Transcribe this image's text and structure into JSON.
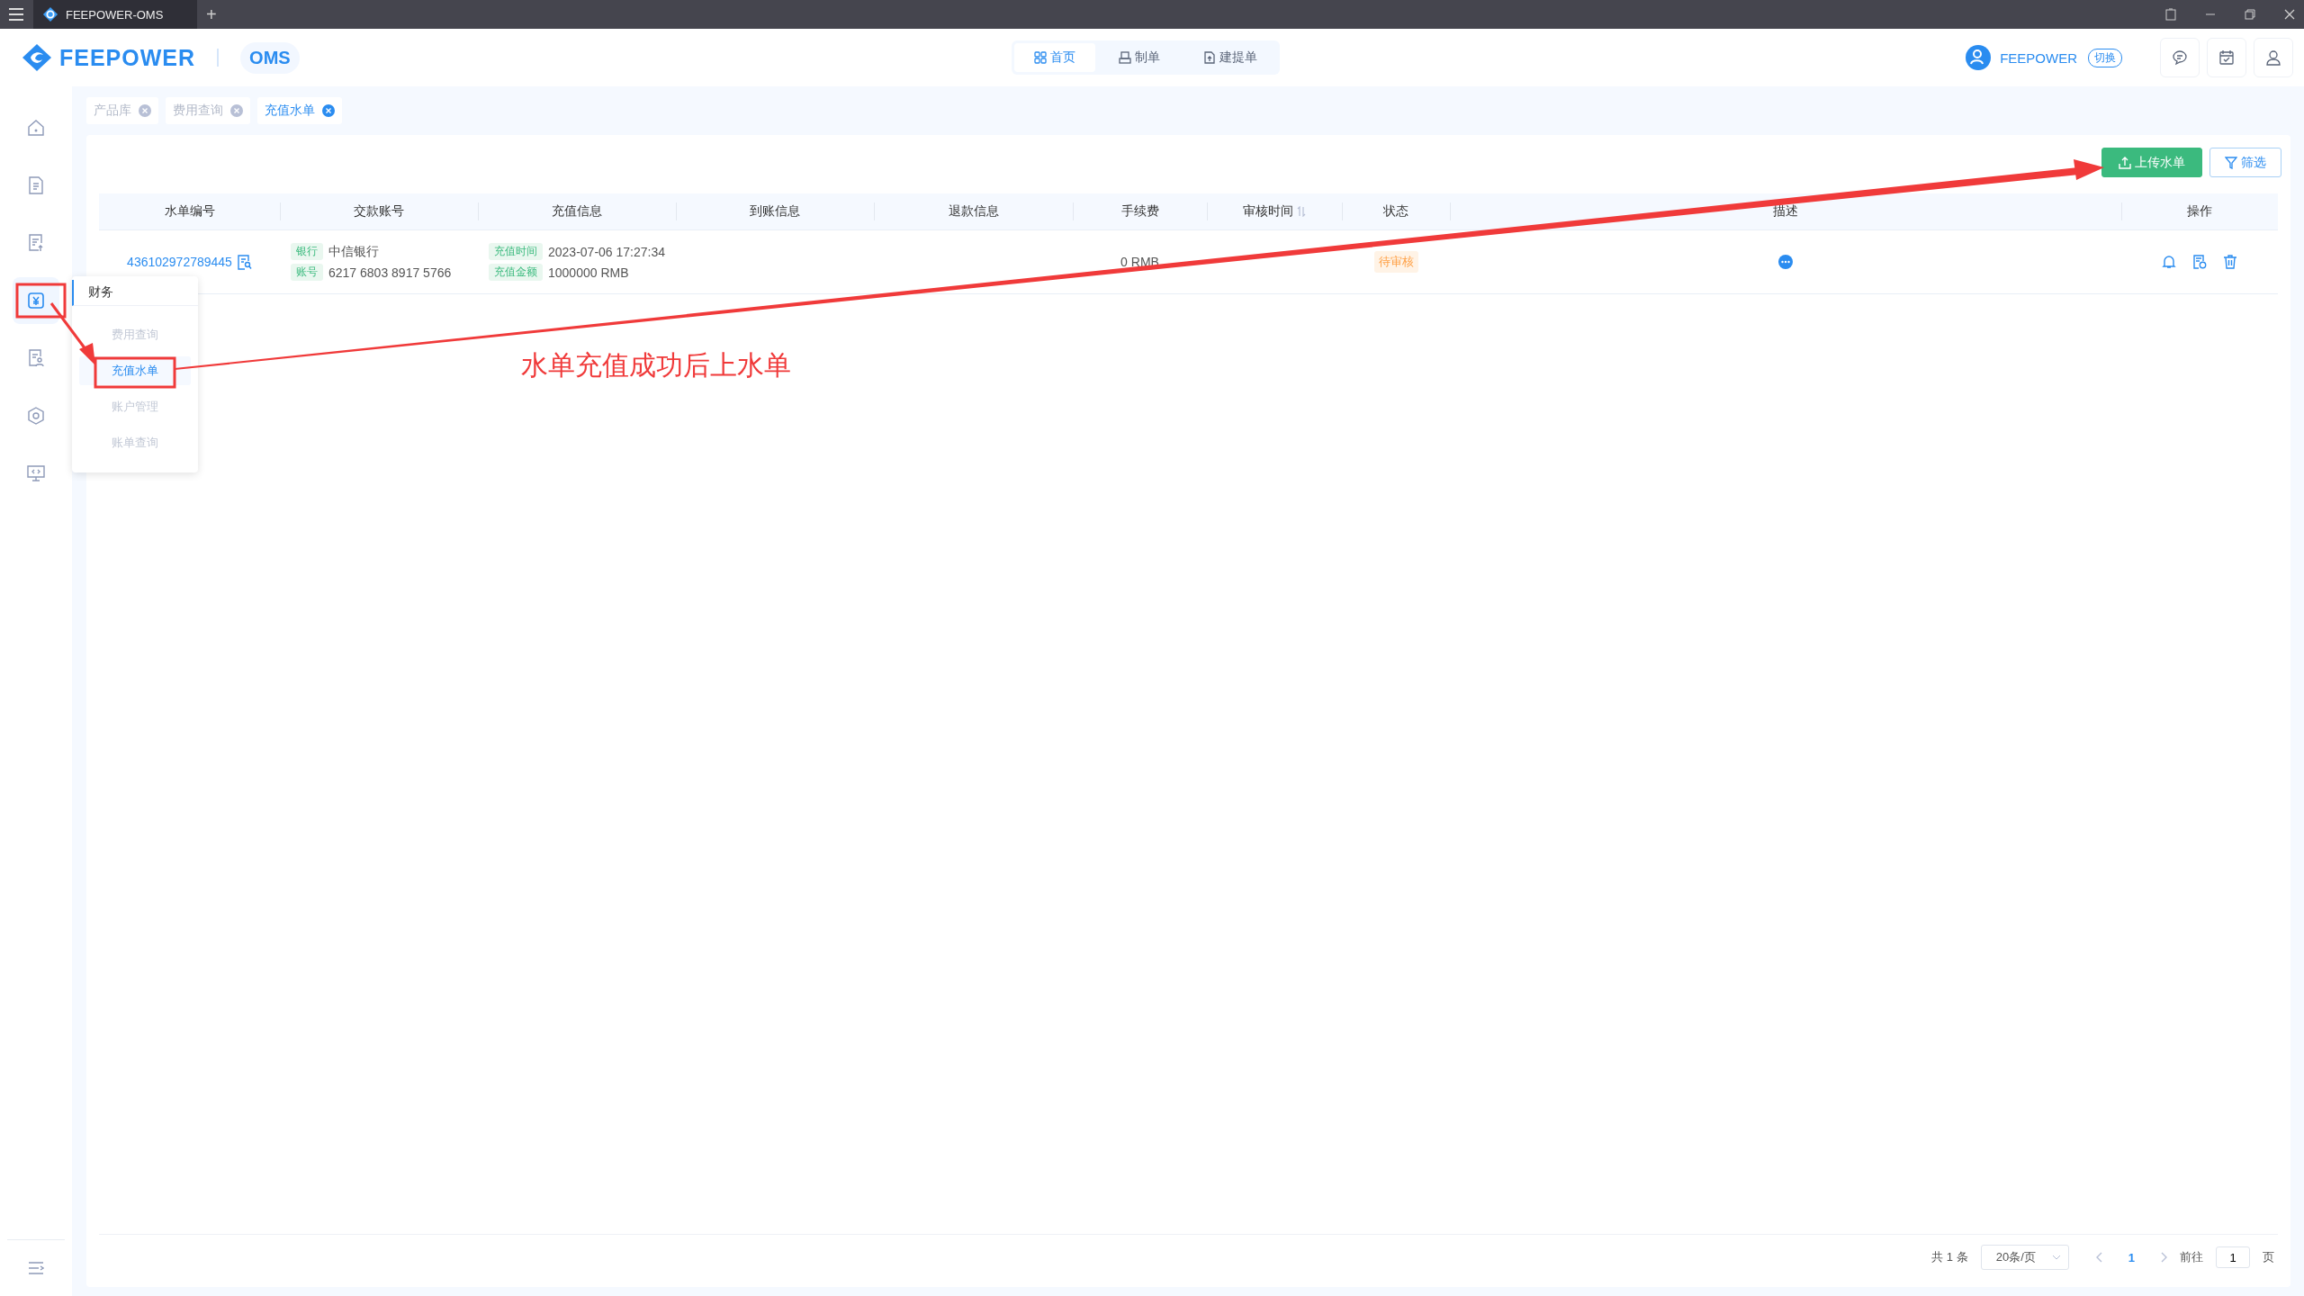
{
  "window": {
    "tab_title": "FEEPOWER-OMS",
    "new_tab": "+"
  },
  "header": {
    "logo": "FEEPOWER",
    "app": "OMS",
    "user": "FEEPOWER",
    "switch": "切换",
    "nav": [
      {
        "label": "首页",
        "kind": "grid",
        "selected": true
      },
      {
        "label": "制单",
        "kind": "print",
        "selected": false
      },
      {
        "label": "建提单",
        "kind": "doc",
        "selected": false
      }
    ]
  },
  "sidebar": {
    "items": [
      {
        "kind": "home",
        "selected": false
      },
      {
        "kind": "document",
        "selected": false
      },
      {
        "kind": "document-arrow",
        "selected": false
      },
      {
        "kind": "finance",
        "selected": true
      },
      {
        "kind": "document-person",
        "selected": false
      },
      {
        "kind": "hexagon",
        "selected": false
      },
      {
        "kind": "monitor",
        "selected": false
      }
    ]
  },
  "menu": {
    "title": "财务",
    "items": [
      {
        "label": "费用查询",
        "selected": false
      },
      {
        "label": "充值水单",
        "selected": true
      },
      {
        "label": "账户管理",
        "selected": false
      },
      {
        "label": "账单查询",
        "selected": false
      }
    ]
  },
  "tabs": [
    {
      "label": "产品库",
      "selected": false
    },
    {
      "label": "费用查询",
      "selected": false
    },
    {
      "label": "充值水单",
      "selected": true
    }
  ],
  "toolbar": {
    "buttons": [
      {
        "label": "上传水单",
        "kind": "primary"
      },
      {
        "label": "筛选",
        "kind": "outline"
      }
    ]
  },
  "table": {
    "columns": [
      {
        "label": "水单编号",
        "sortable": false
      },
      {
        "label": "交款账号",
        "sortable": false
      },
      {
        "label": "充值信息",
        "sortable": false
      },
      {
        "label": "到账信息",
        "sortable": false
      },
      {
        "label": "退款信息",
        "sortable": false
      },
      {
        "label": "手续费",
        "sortable": false
      },
      {
        "label": "审核时间",
        "sortable": true
      },
      {
        "label": "状态",
        "sortable": false
      },
      {
        "label": "描述",
        "sortable": false
      },
      {
        "label": "操作",
        "sortable": false
      }
    ],
    "rows": [
      {
        "id": "436102972789445",
        "payer": [
          {
            "tag": "银行",
            "value": "中信银行"
          },
          {
            "tag": "账号",
            "value": "6217 6803 8917 5766"
          }
        ],
        "recharge": [
          {
            "tag": "充值时间",
            "value": "2023-07-06 17:27:34"
          },
          {
            "tag": "充值金额",
            "value": "1000000 RMB"
          }
        ],
        "fee": "0 RMB",
        "status": "待审核"
      }
    ]
  },
  "pagination": {
    "total": "共 1 条",
    "page_size": "20条/页",
    "pages": [
      {
        "label": "1",
        "selected": true
      }
    ],
    "goto_label": "前往",
    "goto_value": "1",
    "page_unit": "页"
  },
  "annotation": {
    "text": "水单充值成功后上水单"
  }
}
